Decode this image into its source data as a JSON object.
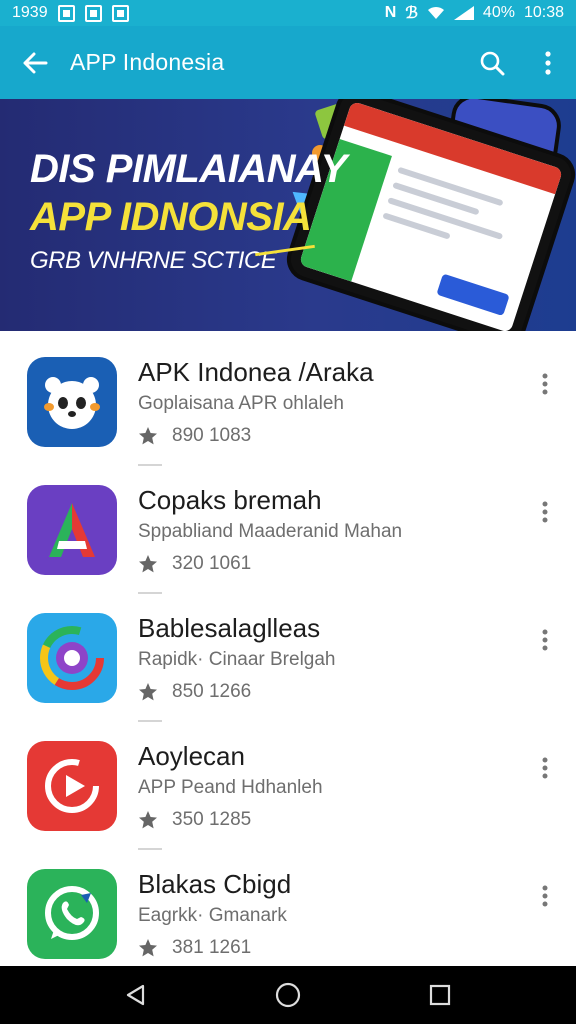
{
  "status_bar": {
    "time_left": "1939",
    "battery_text": "40%",
    "time_right": "10:38"
  },
  "app_bar": {
    "title": "APP Indonesia",
    "back_icon": "arrow-left-icon",
    "search_icon": "search-icon",
    "more_icon": "more-vert-icon"
  },
  "banner": {
    "line1": "DIS PIMLAIANAY",
    "line2": "APP IDNONSIA",
    "line3": "GRB VNHRNE SCTICE"
  },
  "apps": [
    {
      "name": "APK Indonea /Araka",
      "subtitle": "Goplaisana APR ohlaleh",
      "rating": "890 1083",
      "icon": "panda-icon",
      "color": "#1a5fb4"
    },
    {
      "name": "Copaks bremah",
      "subtitle": "Sppabliand Maaderanid Mahan",
      "rating": "320 1061",
      "icon": "letter-a-icon",
      "color": "#6a3fc2"
    },
    {
      "name": "Bablesalaglleas",
      "subtitle": "Rapidk· Cinaar Brelgah",
      "rating": "850 1266",
      "icon": "swirl-icon",
      "color": "#2aa8e8"
    },
    {
      "name": "Aoylecan",
      "subtitle": "APP Peand Hdhanleh",
      "rating": "350 1285",
      "icon": "play-icon",
      "color": "#e53935"
    },
    {
      "name": "Blakas Cbigd",
      "subtitle": "Eagrkk· Gmanark",
      "rating": "381 1261",
      "icon": "chat-phone-icon",
      "color": "#2bb35a"
    }
  ],
  "nav_bar": {
    "back": "back-triangle-icon",
    "home": "home-circle-icon",
    "recents": "recents-square-icon"
  }
}
